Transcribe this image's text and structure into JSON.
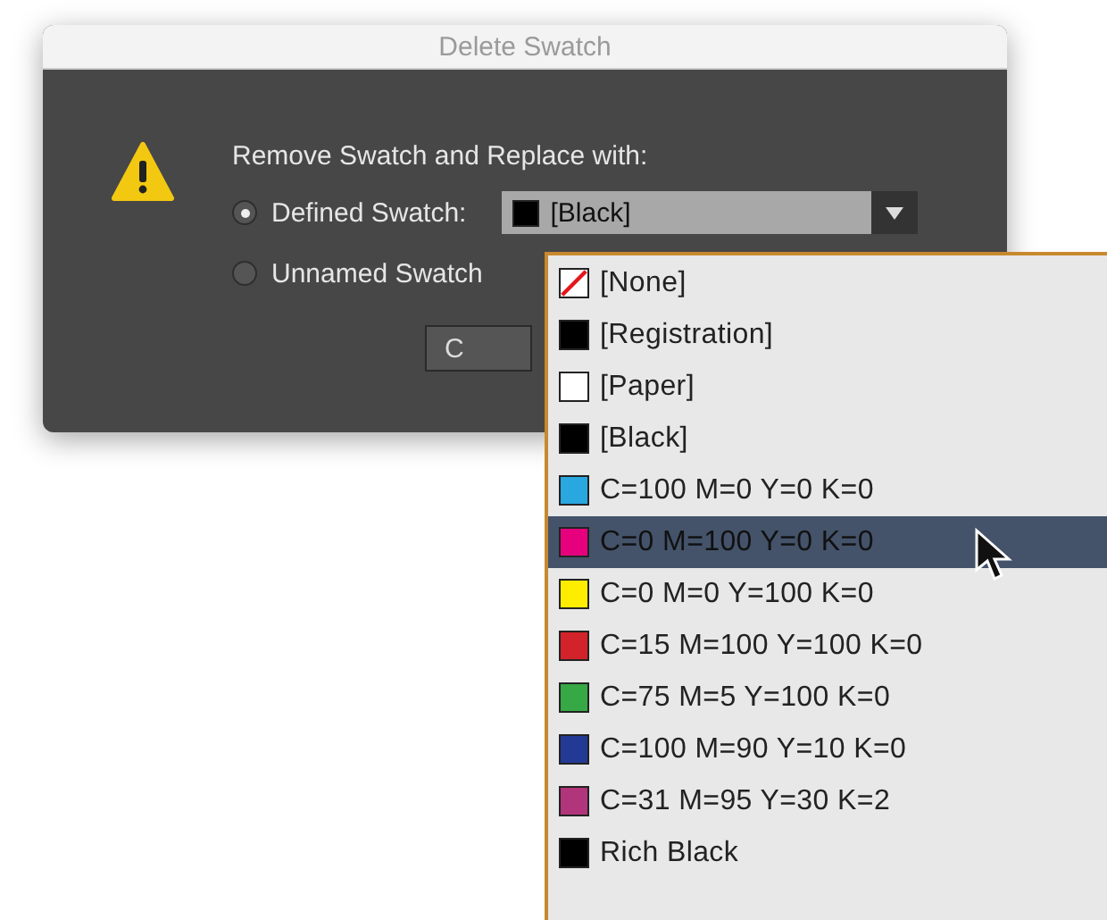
{
  "dialog": {
    "title": "Delete Swatch",
    "prompt": "Remove Swatch and Replace with:",
    "options": [
      {
        "label": "Defined Swatch:",
        "selected": true
      },
      {
        "label": "Unnamed Swatch",
        "selected": false
      }
    ],
    "dropdown": {
      "value": "[Black]",
      "color": "#000000"
    },
    "button": {
      "label": "C"
    }
  },
  "menu": {
    "items": [
      {
        "label": "[None]",
        "kind": "none",
        "selected": false
      },
      {
        "label": "[Registration]",
        "kind": "solid",
        "color": "#000000",
        "selected": false
      },
      {
        "label": "[Paper]",
        "kind": "solid",
        "color": "#ffffff",
        "selected": false
      },
      {
        "label": "[Black]",
        "kind": "solid",
        "color": "#000000",
        "selected": false
      },
      {
        "label": "C=100 M=0 Y=0 K=0",
        "kind": "solid",
        "color": "#29a8e0",
        "selected": false
      },
      {
        "label": "C=0 M=100 Y=0 K=0",
        "kind": "solid",
        "color": "#e6007e",
        "selected": true
      },
      {
        "label": "C=0 M=0 Y=100 K=0",
        "kind": "solid",
        "color": "#ffed00",
        "selected": false
      },
      {
        "label": "C=15 M=100 Y=100 K=0",
        "kind": "solid",
        "color": "#d2232a",
        "selected": false
      },
      {
        "label": "C=75 M=5 Y=100 K=0",
        "kind": "solid",
        "color": "#36a845",
        "selected": false
      },
      {
        "label": "C=100 M=90 Y=10 K=0",
        "kind": "solid",
        "color": "#233a94",
        "selected": false
      },
      {
        "label": "C=31 M=95 Y=30 K=2",
        "kind": "solid",
        "color": "#b0357a",
        "selected": false
      },
      {
        "label": "Rich Black",
        "kind": "solid",
        "color": "#000000",
        "selected": false
      }
    ]
  }
}
